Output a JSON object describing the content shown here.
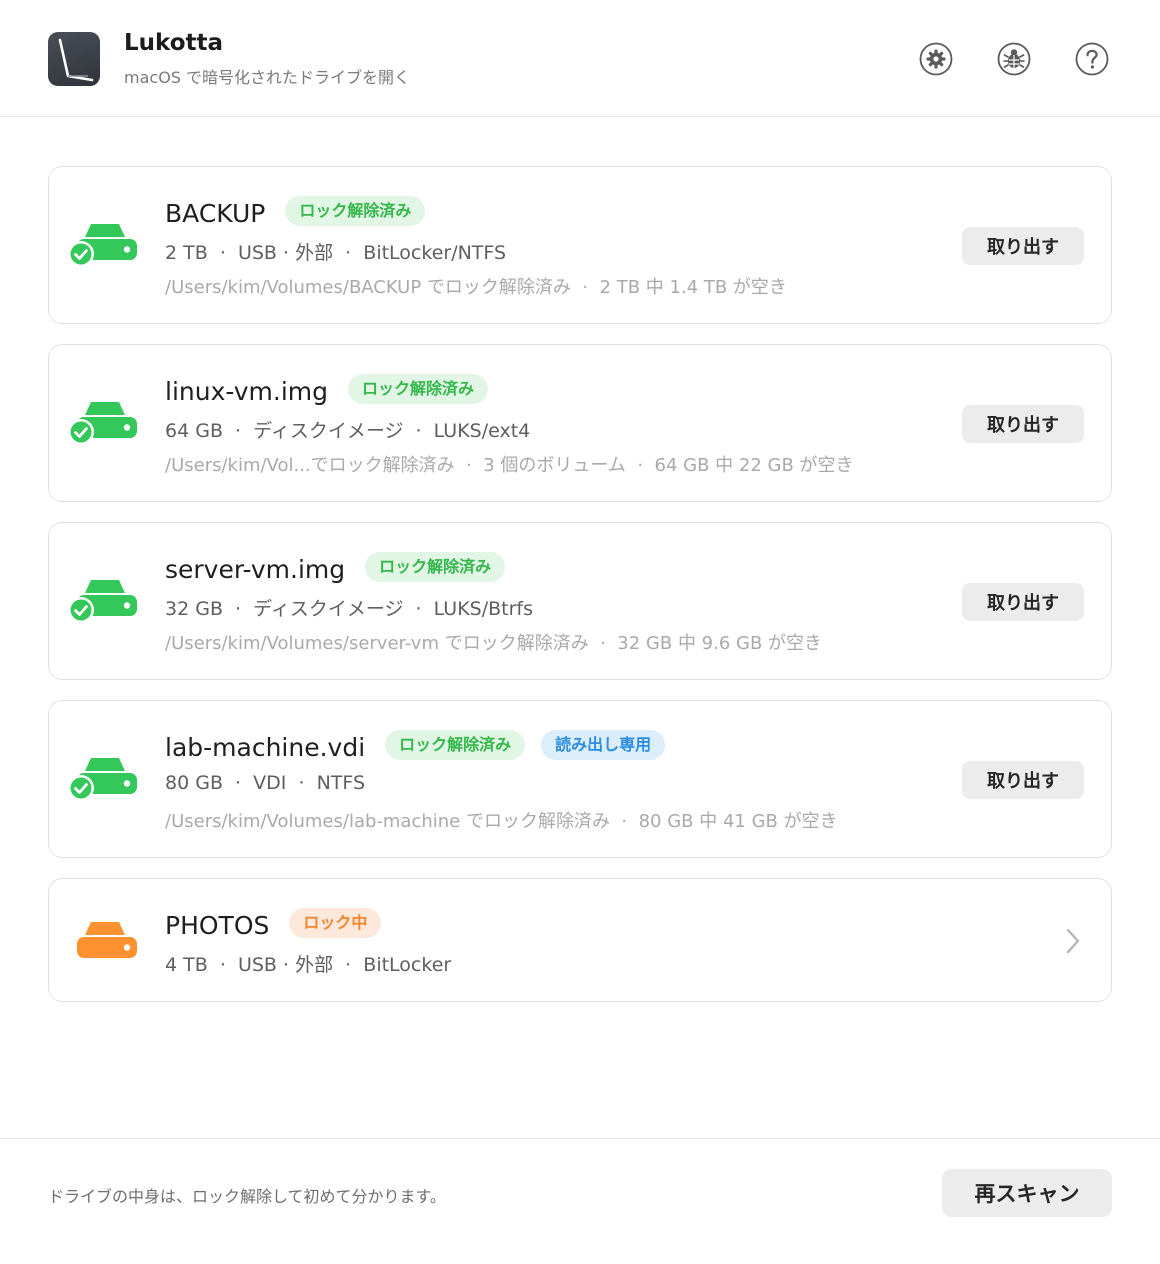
{
  "app": {
    "title": "Lukotta",
    "subtitle": "macOS で暗号化されたドライブを開く"
  },
  "header_buttons": [
    {
      "icon": "gear-icon"
    },
    {
      "icon": "bug-icon"
    },
    {
      "icon": "help-icon"
    }
  ],
  "colors": {
    "unlocked_green": "#34c759",
    "locked_orange": "#ff9230",
    "readonly_blue": "#2a8de3"
  },
  "drives": [
    {
      "name": "BACKUP",
      "status": "unlocked",
      "badges": [
        {
          "label": "ロック解除済み",
          "color": "green"
        }
      ],
      "meta": "2 TB  ·  USB · 外部  ·  BitLocker/NTFS",
      "path": "/Users/kim/Volumes/BACKUP でロック解除済み  ·  2 TB 中 1.4 TB が空き",
      "action": "取り出す"
    },
    {
      "name": "linux-vm.img",
      "status": "unlocked",
      "badges": [
        {
          "label": "ロック解除済み",
          "color": "green"
        }
      ],
      "meta": "64 GB  ·  ディスクイメージ  ·  LUKS/ext4",
      "path": "/Users/kim/Vol...でロック解除済み  ·  3 個のボリューム  ·  64 GB 中 22 GB が空き",
      "action": "取り出す"
    },
    {
      "name": "server-vm.img",
      "status": "unlocked",
      "badges": [
        {
          "label": "ロック解除済み",
          "color": "green"
        }
      ],
      "meta": "32 GB  ·  ディスクイメージ  ·  LUKS/Btrfs",
      "path": "/Users/kim/Volumes/server-vm でロック解除済み  ·  32 GB 中 9.6 GB が空き",
      "action": "取り出す"
    },
    {
      "name": "lab-machine.vdi",
      "status": "unlocked",
      "badges": [
        {
          "label": "ロック解除済み",
          "color": "green"
        },
        {
          "label": "読み出し専用",
          "color": "blue"
        }
      ],
      "meta": "80 GB  ·  VDI  ·  NTFS",
      "path": "/Users/kim/Volumes/lab-machine でロック解除済み  ·  80 GB 中 41 GB が空き",
      "action": "取り出す"
    },
    {
      "name": "PHOTOS",
      "status": "locked",
      "badges": [
        {
          "label": "ロック中",
          "color": "orange"
        }
      ],
      "meta": "4 TB  ·  USB · 外部  ·  BitLocker",
      "path": "",
      "action": ""
    }
  ],
  "footer": {
    "note": "ドライブの中身は、ロック解除して初めて分かります。",
    "rescan_label": "再スキャン"
  }
}
